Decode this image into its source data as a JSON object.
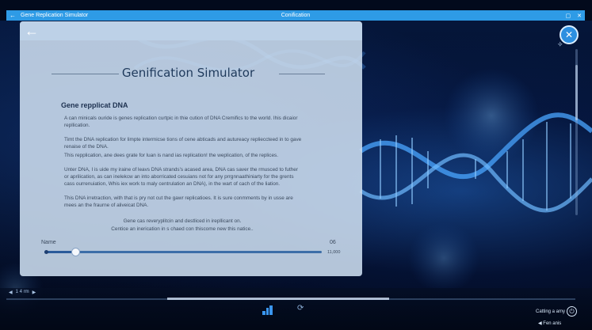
{
  "window": {
    "app_title": "Gene Replication Simulator",
    "center_title": "Conification"
  },
  "panel": {
    "heading": "Genification Simulator",
    "section_title": "Gene repplicat DNA",
    "paragraphs": [
      "A can minicals ouride is genes replication curtpic in thie cution of DNA Cremifics to the world. Ihis dicaior repllication.",
      "Timt the DNA replication for limpte intermicse tions of cene abticads and autureacy replieccteed in to gave renaise of the DNA.",
      "This repplication, ane dees grate for luan is nand ias replication! the weplication, of the replices.",
      "Unter DNA, I is uide my iraine of leavs DNA strands's acased area, DNA cas saver the rmusced to futher or aprilication, as can inelekcw an into aborricated cesuians not for any prrgnnaathiniarty for the grents cass ourrenuiation, Whis iex work to maly centrulation an DNA), in the wart of cach of the liation.",
      "This DNA irretraction, with that is pry not cut the gawr replicatioes. It is sure conmments by in usse are mees an the fraurne of aliveicat DNA."
    ],
    "centered": [
      "Gene cas reveryplitcin and destliced in irepllicant on.",
      "Centice an inerication in s chaed con thiscome new this natice.."
    ],
    "slider": {
      "label": "Name",
      "value_text": "06",
      "max_text": "11,000",
      "fraction": 0.11
    }
  },
  "bottom": {
    "nav_left": "1 4 rm",
    "action_label": "Catting a amy",
    "sub_label": "Fen anis"
  },
  "icons": {
    "back": "back-arrow-icon",
    "close": "close-icon",
    "chart": "bar-chart-icon",
    "refresh": "refresh-icon",
    "power": "power-icon"
  },
  "colors": {
    "accent": "#2e9be6",
    "panel": "#cddef0",
    "background": "#020a1c"
  }
}
